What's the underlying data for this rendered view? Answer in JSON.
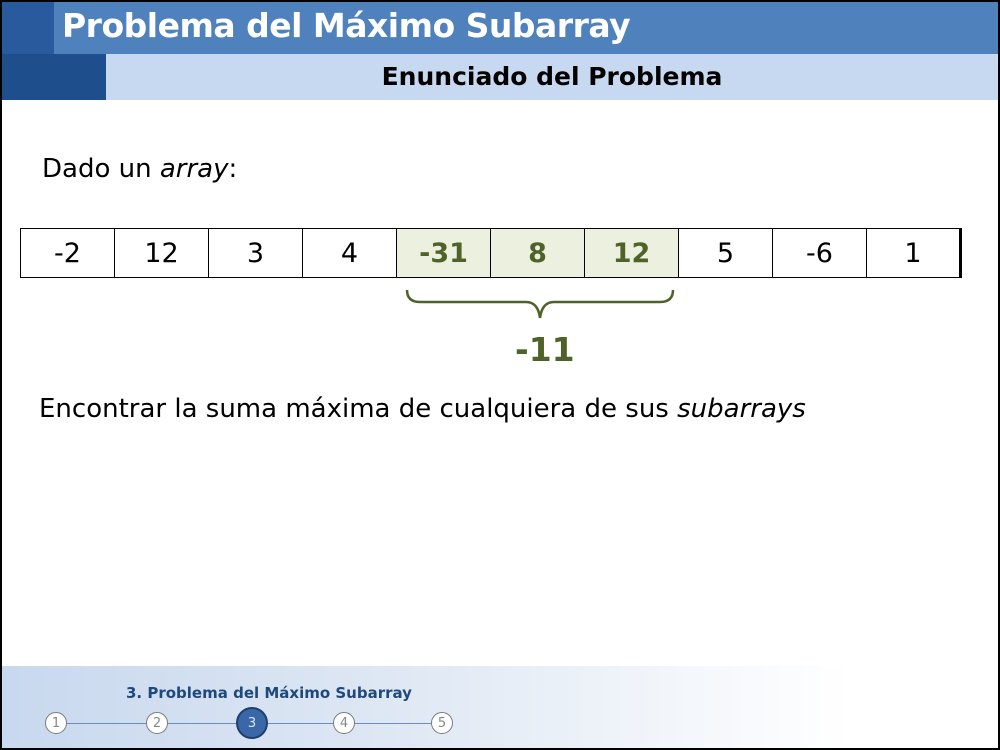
{
  "header": {
    "title": "Problema del Máximo Subarray",
    "subtitle": "Enunciado del Problema"
  },
  "content": {
    "given_prefix": "Dado un ",
    "given_italic": "array",
    "given_suffix": ":",
    "array": [
      "-2",
      "12",
      "3",
      "4",
      "-31",
      "8",
      "12",
      "5",
      "-6",
      "1"
    ],
    "highlighted_indices": [
      4,
      5,
      6
    ],
    "highlight_sum": "-11",
    "statement_prefix": "Encontrar la suma máxima de cualquiera de sus ",
    "statement_italic": "subarrays"
  },
  "footer": {
    "section_label": "3. Problema del Máximo Subarray",
    "steps": [
      "1",
      "2",
      "3",
      "4",
      "5"
    ],
    "active_step": 3
  },
  "colors": {
    "title_bar": "#4f81bd",
    "subtitle_bar": "#c6d9f1",
    "highlight_fill": "#ebf1de",
    "highlight_text": "#4f6228"
  }
}
